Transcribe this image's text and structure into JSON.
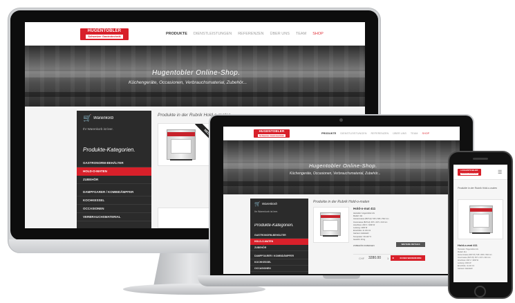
{
  "site": {
    "logo_top": "HUGENTOBLER",
    "logo_sub": "Schweizer Gastrotechnik",
    "nav": [
      "PRODUKTE",
      "DIENSTLEISTUNGEN",
      "REFERENZEN",
      "ÜBER UNS",
      "TEAM",
      "SHOP"
    ],
    "hero_title": "Hugentobler Online-Shop.",
    "hero_subtitle": "Küchengeräte, Occasionen, Verbrauchsmaterial, Zubehör...",
    "cart_title": "Warenkorb",
    "cart_empty": "Ihr Warenkorb ist leer.",
    "categories_title": "Produkte-Kategorien.",
    "categories": [
      "GASTRONORM-BEHÄLTER",
      "HOLD-O-MATEN",
      "ZUBEHÖR",
      "DAMPFGARER / KOMBIDÄMPFER",
      "KOCHKESSEL",
      "OCCASIONEN",
      "VERBRAUCHSMATERIAL"
    ],
    "products_heading": "Produkte in der Rubrik Hold-o-maten",
    "badge": "NEU",
    "product": {
      "name": "Hold-o-mat 411",
      "lines": [
        "Hersteller: Hugentobler AG",
        "Modell: 411",
        "Aussenmasse (BxTxH): 515 x 606 x 502 mm",
        "Innenmasse (BxTxH): 367 x 347 x 310 mm",
        "Anschluss: 230 V / 1000 W",
        "Leistung: 1000 W",
        "Einschübe: 4x GN 1/1",
        "Garraum: Edelstahl",
        "Temperatur: 30-120 °C",
        "Gewicht: 40 kg"
      ],
      "related_label": "ZUBEHÖR ANZEIGEN",
      "details_label": "WEITERE DETAILS",
      "qty": "1",
      "price": "3280.00",
      "currency": "CHF",
      "cart_button": "IN DEN WARENKORB"
    }
  },
  "colors": {
    "brand_red": "#d8202a",
    "sidebar_dark": "#2b2b2b",
    "device_silver": "#cfd1d3"
  }
}
